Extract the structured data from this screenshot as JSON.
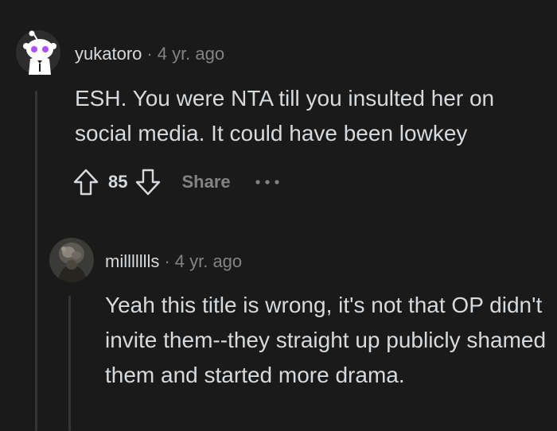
{
  "comments": [
    {
      "author": "yukatoro",
      "separator": "·",
      "time": "4 yr. ago",
      "body": "ESH. You were NTA till you insulted her on social media. It could have been lowkey",
      "score": "85",
      "share_label": "Share"
    },
    {
      "author": "millllllls",
      "separator": "·",
      "time": "4 yr. ago",
      "body": "Yeah this title is wrong, it's not that OP didn't invite them--they straight up publicly shamed them and started more drama."
    }
  ],
  "icons": {
    "upvote": "arrow-up-outline",
    "downvote": "arrow-down-outline",
    "more": "horizontal-ellipsis"
  },
  "colors": {
    "background": "#1a1a1b",
    "text": "#d7dadc",
    "muted": "#818384",
    "thread_line": "#343536",
    "avatar_accent": "#b04fff"
  }
}
